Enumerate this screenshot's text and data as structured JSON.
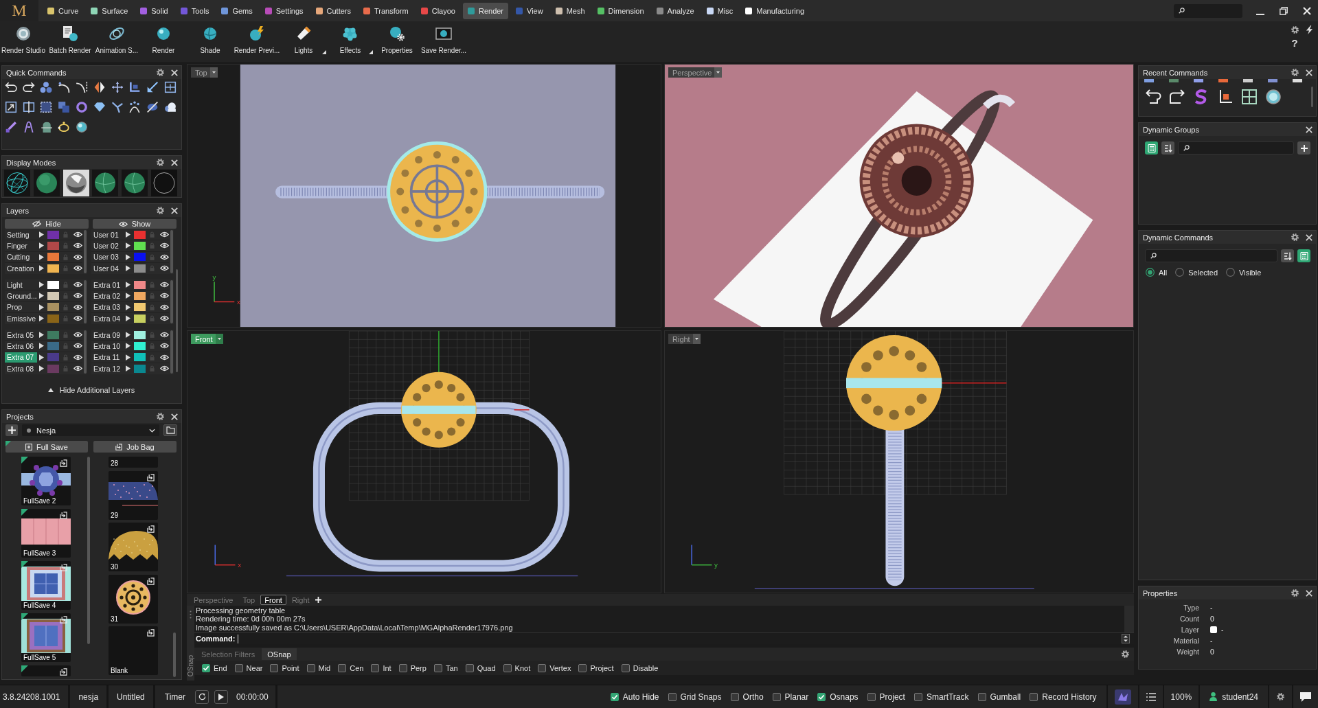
{
  "logo": "M",
  "menu_tabs": [
    {
      "label": "Curve",
      "color": "#d9c46c",
      "selected": false
    },
    {
      "label": "Surface",
      "color": "#8fd6b6",
      "selected": false
    },
    {
      "label": "Solid",
      "color": "#a25fe0",
      "selected": false
    },
    {
      "label": "Tools",
      "color": "#7357d8",
      "selected": false
    },
    {
      "label": "Gems",
      "color": "#6f96da",
      "selected": false
    },
    {
      "label": "Settings",
      "color": "#b84cb8",
      "selected": false
    },
    {
      "label": "Cutters",
      "color": "#e6a77a",
      "selected": false
    },
    {
      "label": "Transform",
      "color": "#e86b4b",
      "selected": false
    },
    {
      "label": "Clayoo",
      "color": "#e84848",
      "selected": false
    },
    {
      "label": "Render",
      "color": "#2f9b9b",
      "selected": true
    },
    {
      "label": "View",
      "color": "#3457a8",
      "selected": false
    },
    {
      "label": "Mesh",
      "color": "#cebfae",
      "selected": false
    },
    {
      "label": "Dimension",
      "color": "#55c064",
      "selected": false
    },
    {
      "label": "Analyze",
      "color": "#8a8a8a",
      "selected": false
    },
    {
      "label": "Misc",
      "color": "#c9d8f5",
      "selected": false
    },
    {
      "label": "Manufacturing",
      "color": "#ffffff",
      "selected": false
    }
  ],
  "toolbar": [
    {
      "label": "Render Studio",
      "flyout": false
    },
    {
      "label": "Batch Render",
      "flyout": false
    },
    {
      "label": "Animation S...",
      "flyout": false
    },
    {
      "label": "Render",
      "flyout": false
    },
    {
      "label": "Shade",
      "flyout": false
    },
    {
      "label": "Render Previ...",
      "flyout": false
    },
    {
      "label": "Lights",
      "flyout": true
    },
    {
      "label": "Effects",
      "flyout": true
    },
    {
      "label": "Properties",
      "flyout": false
    },
    {
      "label": "Save Render...",
      "flyout": false
    }
  ],
  "help": "?",
  "quick_commands": {
    "title": "Quick Commands",
    "settings_button": true
  },
  "display_modes": {
    "title": "Display Modes",
    "settings_button": true,
    "modes": [
      {
        "kind": "wireframe"
      },
      {
        "kind": "shaded"
      },
      {
        "kind": "metal"
      },
      {
        "kind": "edged"
      },
      {
        "kind": "edged"
      },
      {
        "kind": "outline"
      }
    ]
  },
  "layers": {
    "title": "Layers",
    "settings_button": true,
    "hide": "Hide",
    "show": "Show",
    "columns": [
      [
        [
          {
            "name": "Setting",
            "color": "#7030a8",
            "selected": false
          },
          {
            "name": "Finger",
            "color": "#b04848",
            "selected": false
          },
          {
            "name": "Cutting",
            "color": "#e8783a",
            "selected": false
          },
          {
            "name": "Creation",
            "color": "#f0b450",
            "selected": false
          }
        ],
        [
          {
            "name": "Light",
            "color": "#ffffff",
            "selected": false
          },
          {
            "name": "Ground...",
            "color": "#d2c8b4",
            "selected": false
          },
          {
            "name": "Prop",
            "color": "#a89060",
            "selected": false
          },
          {
            "name": "Emissive",
            "color": "#8a6418",
            "selected": false
          }
        ],
        [
          {
            "name": "Extra 05",
            "color": "#3e7a60",
            "selected": false
          },
          {
            "name": "Extra 06",
            "color": "#3a6a88",
            "selected": false
          },
          {
            "name": "Extra 07",
            "color": "#4a3a8a",
            "selected": true
          },
          {
            "name": "Extra 08",
            "color": "#6a3a60",
            "selected": false
          }
        ]
      ],
      [
        [
          {
            "name": "User 01",
            "color": "#e83030",
            "selected": false
          },
          {
            "name": "User 02",
            "color": "#60e050",
            "selected": false
          },
          {
            "name": "User 03",
            "color": "#0a10f0",
            "selected": false
          },
          {
            "name": "User 04",
            "color": "#8c8c8c",
            "selected": false
          }
        ],
        [
          {
            "name": "Extra 01",
            "color": "#f08888",
            "selected": false
          },
          {
            "name": "Extra 02",
            "color": "#f0a860",
            "selected": false
          },
          {
            "name": "Extra 03",
            "color": "#f0c870",
            "selected": false
          },
          {
            "name": "Extra 04",
            "color": "#c8d060",
            "selected": false
          }
        ],
        [
          {
            "name": "Extra 09",
            "color": "#a0f0e0",
            "selected": false
          },
          {
            "name": "Extra 10",
            "color": "#30f0d0",
            "selected": false
          },
          {
            "name": "Extra 11",
            "color": "#10c0b8",
            "selected": false
          },
          {
            "name": "Extra 12",
            "color": "#0a8890",
            "selected": false
          }
        ]
      ]
    ],
    "footer": "Hide Additional Layers"
  },
  "projects": {
    "title": "Projects",
    "settings_button": true,
    "project": "Nesja",
    "buttons": [
      "Full Save",
      "Job Bag"
    ],
    "thumbnails": [
      [
        {
          "label": "FullSave 2",
          "kind": "round-gem",
          "flagged": true
        },
        {
          "label": "FullSave 3",
          "kind": "band",
          "flagged": true
        },
        {
          "label": "FullSave 4",
          "kind": "square-gem",
          "flagged": true
        },
        {
          "label": "FullSave 5",
          "kind": "framed-gem",
          "flagged": true
        },
        {
          "kind": "cut-bottom",
          "flagged": true
        }
      ],
      [
        {
          "label": "28",
          "kind": "cut-top",
          "flagged": false
        },
        {
          "label": "29",
          "kind": "speckled",
          "flagged": false
        },
        {
          "label": "30",
          "kind": "dome",
          "flagged": false
        },
        {
          "label": "31",
          "kind": "filigree",
          "flagged": false
        },
        {
          "label": "Blank",
          "kind": "blank",
          "flagged": false
        }
      ]
    ]
  },
  "viewports": [
    {
      "label": "Top",
      "active": false,
      "kind": "top",
      "axis": {
        "vertical": "y",
        "horizontal": "x"
      }
    },
    {
      "label": "Perspective",
      "active": false,
      "kind": "perspective"
    },
    {
      "label": "Front",
      "active": true,
      "kind": "front",
      "axis": {
        "horizontal": "x"
      }
    },
    {
      "label": "Right",
      "active": false,
      "kind": "right",
      "axis": {
        "horizontal": "y"
      }
    }
  ],
  "command_tabs": [
    {
      "label": "Perspective",
      "selected": false
    },
    {
      "label": "Top",
      "selected": false
    },
    {
      "label": "Front",
      "selected": true
    },
    {
      "label": "Right",
      "selected": false
    }
  ],
  "command_history": [
    "Processing geometry table",
    "Rendering time: 0d 00h 00m 27s",
    "Image successfully saved as C:\\Users\\USER\\AppData\\Local\\Temp\\MGAlphaRender17976.png"
  ],
  "command_prompt": "Command:",
  "snap_side_label": "OSnap",
  "snap_tabs": [
    {
      "label": "Selection Filters",
      "selected": false
    },
    {
      "label": "OSnap",
      "selected": true
    }
  ],
  "osnaps": [
    {
      "label": "End",
      "checked": true
    },
    {
      "label": "Near",
      "checked": false
    },
    {
      "label": "Point",
      "checked": false
    },
    {
      "label": "Mid",
      "checked": false
    },
    {
      "label": "Cen",
      "checked": false
    },
    {
      "label": "Int",
      "checked": false
    },
    {
      "label": "Perp",
      "checked": false
    },
    {
      "label": "Tan",
      "checked": false
    },
    {
      "label": "Quad",
      "checked": false
    },
    {
      "label": "Knot",
      "checked": false
    },
    {
      "label": "Vertex",
      "checked": false
    },
    {
      "label": "Project",
      "checked": false
    },
    {
      "label": "Disable",
      "checked": false
    }
  ],
  "recent_commands": {
    "title": "Recent Commands",
    "settings_button": true
  },
  "dynamic_groups": {
    "title": "Dynamic Groups",
    "settings_button": false
  },
  "dynamic_commands": {
    "title": "Dynamic Commands",
    "settings_button": true,
    "filters": [
      {
        "label": "All",
        "selected": true
      },
      {
        "label": "Selected",
        "selected": false
      },
      {
        "label": "Visible",
        "selected": false
      }
    ]
  },
  "properties": {
    "title": "Properties",
    "settings_button": true,
    "rows": [
      {
        "label": "Type",
        "value": "-"
      },
      {
        "label": "Count",
        "value": "0"
      },
      {
        "label": "Layer",
        "value": "-",
        "color": "#ffffff"
      },
      {
        "label": "Material",
        "value": "-"
      },
      {
        "label": "Weight",
        "value": "0"
      }
    ]
  },
  "status_bar": {
    "version": "3.8.24208.1001",
    "folder": "nesja",
    "document": "Untitled",
    "timer_label": "Timer",
    "timer": "00:00:00",
    "toggles": [
      {
        "label": "Auto Hide",
        "checked": true
      },
      {
        "label": "Grid Snaps",
        "checked": false
      },
      {
        "label": "Ortho",
        "checked": false
      },
      {
        "label": "Planar",
        "checked": false
      },
      {
        "label": "Osnaps",
        "checked": true
      },
      {
        "label": "Project",
        "checked": false
      },
      {
        "label": "SmartTrack",
        "checked": false
      },
      {
        "label": "Gumball",
        "checked": false
      },
      {
        "label": "Record History",
        "checked": false
      }
    ],
    "zoom": "100%",
    "user": "student24"
  }
}
